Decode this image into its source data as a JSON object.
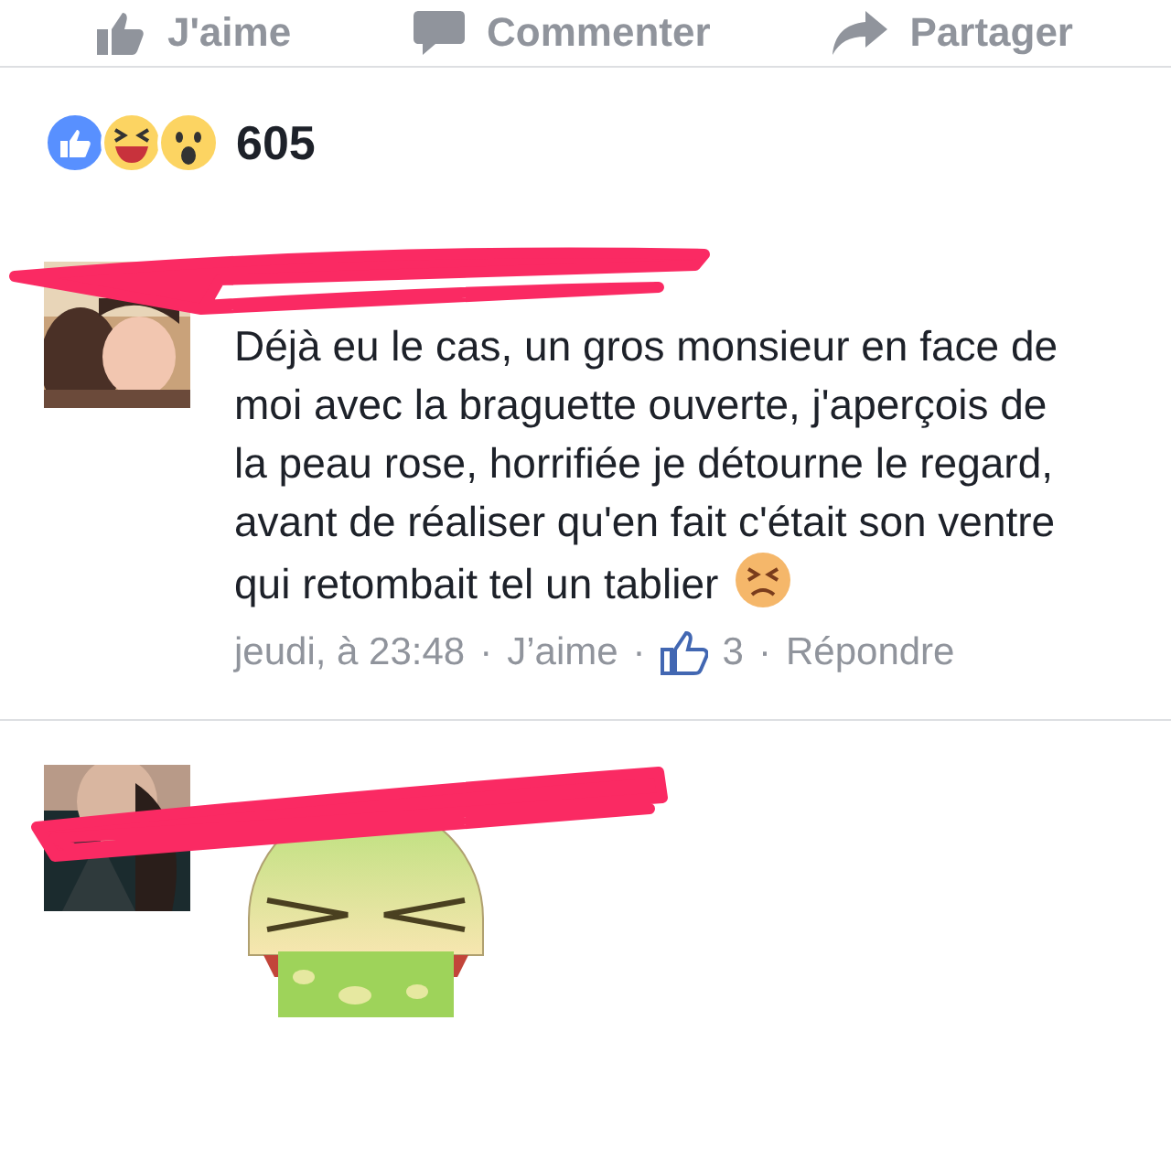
{
  "actions": [
    {
      "label": "J'aime",
      "kind": "like"
    },
    {
      "label": "Commenter",
      "kind": "comment"
    },
    {
      "label": "Partager",
      "kind": "share"
    }
  ],
  "reactions": {
    "count": "605"
  },
  "comments": [
    {
      "kind": "text",
      "text": "Déjà eu le cas, un gros monsieur en face de moi avec la braguette ouverte, j'aperçois de la peau rose, horrifiée je détourne le regard, avant de réaliser qu'en fait c'était son ventre qui retombait tel un tablier",
      "time": "jeudi, à 23:48",
      "separator": "·",
      "like_label": "J’aime",
      "likes": "3",
      "reply_label": "Répondre"
    },
    {
      "kind": "sticker"
    }
  ]
}
